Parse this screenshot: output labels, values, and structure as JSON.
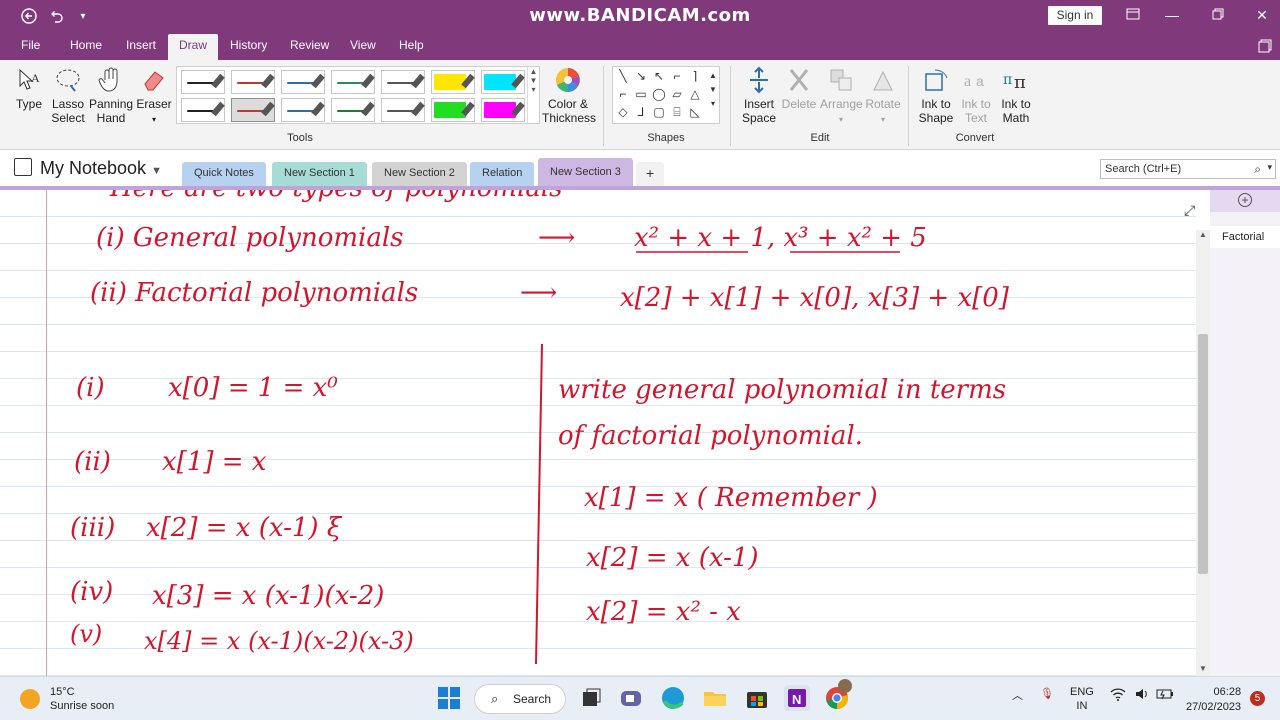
{
  "titlebar": {
    "title": "www.BANDICAM.com",
    "sign_in": "Sign in",
    "back_icon": "back-arrow-icon",
    "undo_icon": "undo-icon"
  },
  "menu": {
    "tabs": [
      "File",
      "Home",
      "Insert",
      "Draw",
      "History",
      "Review",
      "View",
      "Help"
    ],
    "active": "Draw"
  },
  "ribbon": {
    "tools": {
      "type": "Type",
      "lasso": "Lasso Select",
      "lasso_1": "Lasso",
      "lasso_2": "Select",
      "panning_1": "Panning",
      "panning_2": "Hand",
      "eraser": "Eraser",
      "group": "Tools",
      "color_1": "Color &",
      "color_2": "Thickness"
    },
    "pen_colors": [
      "#222222",
      "#c0392b",
      "#2c6fb0",
      "#2e8b57",
      "#555555",
      "#ffe600",
      "#00e5ff",
      "#222222",
      "#c0392b",
      "#2c6fb0",
      "#1e7d32",
      "#555555",
      "#22dd22",
      "#ff00ff"
    ],
    "shapes_group": "Shapes",
    "edit": {
      "insert_space_1": "Insert",
      "insert_space_2": "Space",
      "delete": "Delete",
      "arrange": "Arrange",
      "rotate": "Rotate",
      "group": "Edit"
    },
    "convert": {
      "ink_shape_1": "Ink to",
      "ink_shape_2": "Shape",
      "ink_text_1": "Ink to",
      "ink_text_2": "Text",
      "ink_math_1": "Ink to",
      "ink_math_2": "Math",
      "group": "Convert"
    }
  },
  "notebook": {
    "name": "My Notebook",
    "sections": [
      {
        "label": "Quick Notes",
        "color": "#b7d1f0"
      },
      {
        "label": "New Section 1",
        "color": "#a7dcd6"
      },
      {
        "label": "New Section 2",
        "color": "#d3d3d3"
      },
      {
        "label": "Relation",
        "color": "#b7d1f0"
      },
      {
        "label": "New Section 3",
        "color": "#cdb8e3"
      }
    ],
    "add_section": "+",
    "search_placeholder": "Search (Ctrl+E)"
  },
  "pages": {
    "current": "Factorial",
    "add_page": "+"
  },
  "notes": {
    "header_partial": "Here are two types of polynomials",
    "line1_label": "(i) General polynomials",
    "line1_math": "x² + x + 1,   x³ + x² + 5",
    "line2_label": "(ii) Factorial polynomials",
    "line2_math": "x[2] + x[1] + x[0],   x[3] + x[0]",
    "left": [
      {
        "num": "(i)",
        "expr": "x[0] = 1 = x⁰"
      },
      {
        "num": "(ii)",
        "expr": "x[1] = x"
      },
      {
        "num": "(iii)",
        "expr": "x[2] = x (x-1) ξ"
      },
      {
        "num": "(iv)",
        "expr": "x[3] = x (x-1)(x-2)"
      },
      {
        "num": "(v)",
        "expr": "x[4] = x (x-1)(x-2)(x-3)"
      }
    ],
    "right_heading_1": "write general polynomial in terms",
    "right_heading_2": "of factorial polynomial.",
    "right_lines": [
      "x[1] = x      ( Remember )",
      "x[2] = x (x-1)",
      "x[2] = x² - x"
    ]
  },
  "taskbar": {
    "temp": "15°C",
    "weather": "Sunrise soon",
    "search": "Search",
    "lang_1": "ENG",
    "lang_2": "IN",
    "time": "06:28",
    "date": "27/02/2023",
    "notifications": "5"
  }
}
